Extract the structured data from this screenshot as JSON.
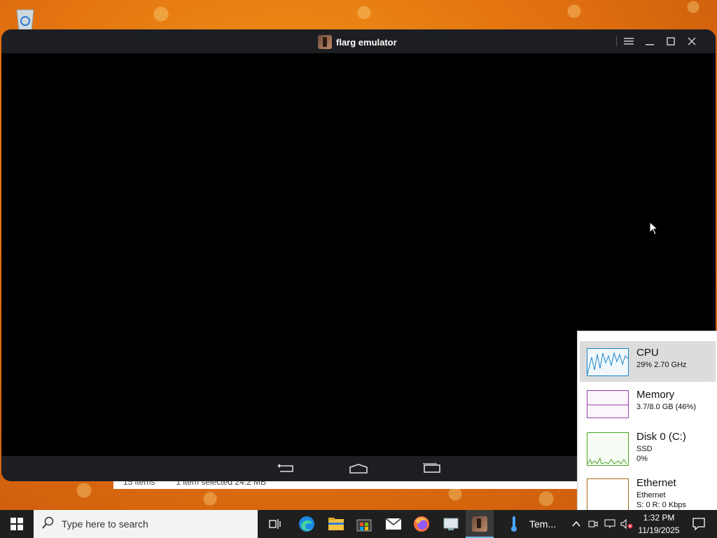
{
  "window": {
    "title": "flarg emulator",
    "menu_icon": "hamburger-icon",
    "minimize_icon": "minimize-icon",
    "maximize_icon": "maximize-icon",
    "close_icon": "close-icon"
  },
  "emulator_nav": {
    "back_icon": "back-icon",
    "home_icon": "home-icon",
    "recents_icon": "recents-icon"
  },
  "explorer_status": {
    "items": "15 items",
    "selected": "1 item selected  24.2 MB"
  },
  "task_manager": {
    "cpu": {
      "name": "CPU",
      "detail": "29%  2.70 GHz",
      "graph_color": "#1a86c9"
    },
    "memory": {
      "name": "Memory",
      "detail": "3.7/8.0 GB (46%)",
      "graph_color": "#9b3fb0"
    },
    "disk": {
      "name": "Disk 0 (C:)",
      "type": "SSD",
      "usage": "0%",
      "graph_color": "#4da626"
    },
    "ethernet": {
      "name": "Ethernet",
      "type": "Ethernet",
      "rate": "S: 0 R: 0 Kbps",
      "graph_color": "#a76a1c"
    }
  },
  "taskbar": {
    "search_placeholder": "Type here to search",
    "temp_app_label": "Tem...",
    "time": "1:32 PM",
    "date": "11/19/2025"
  }
}
